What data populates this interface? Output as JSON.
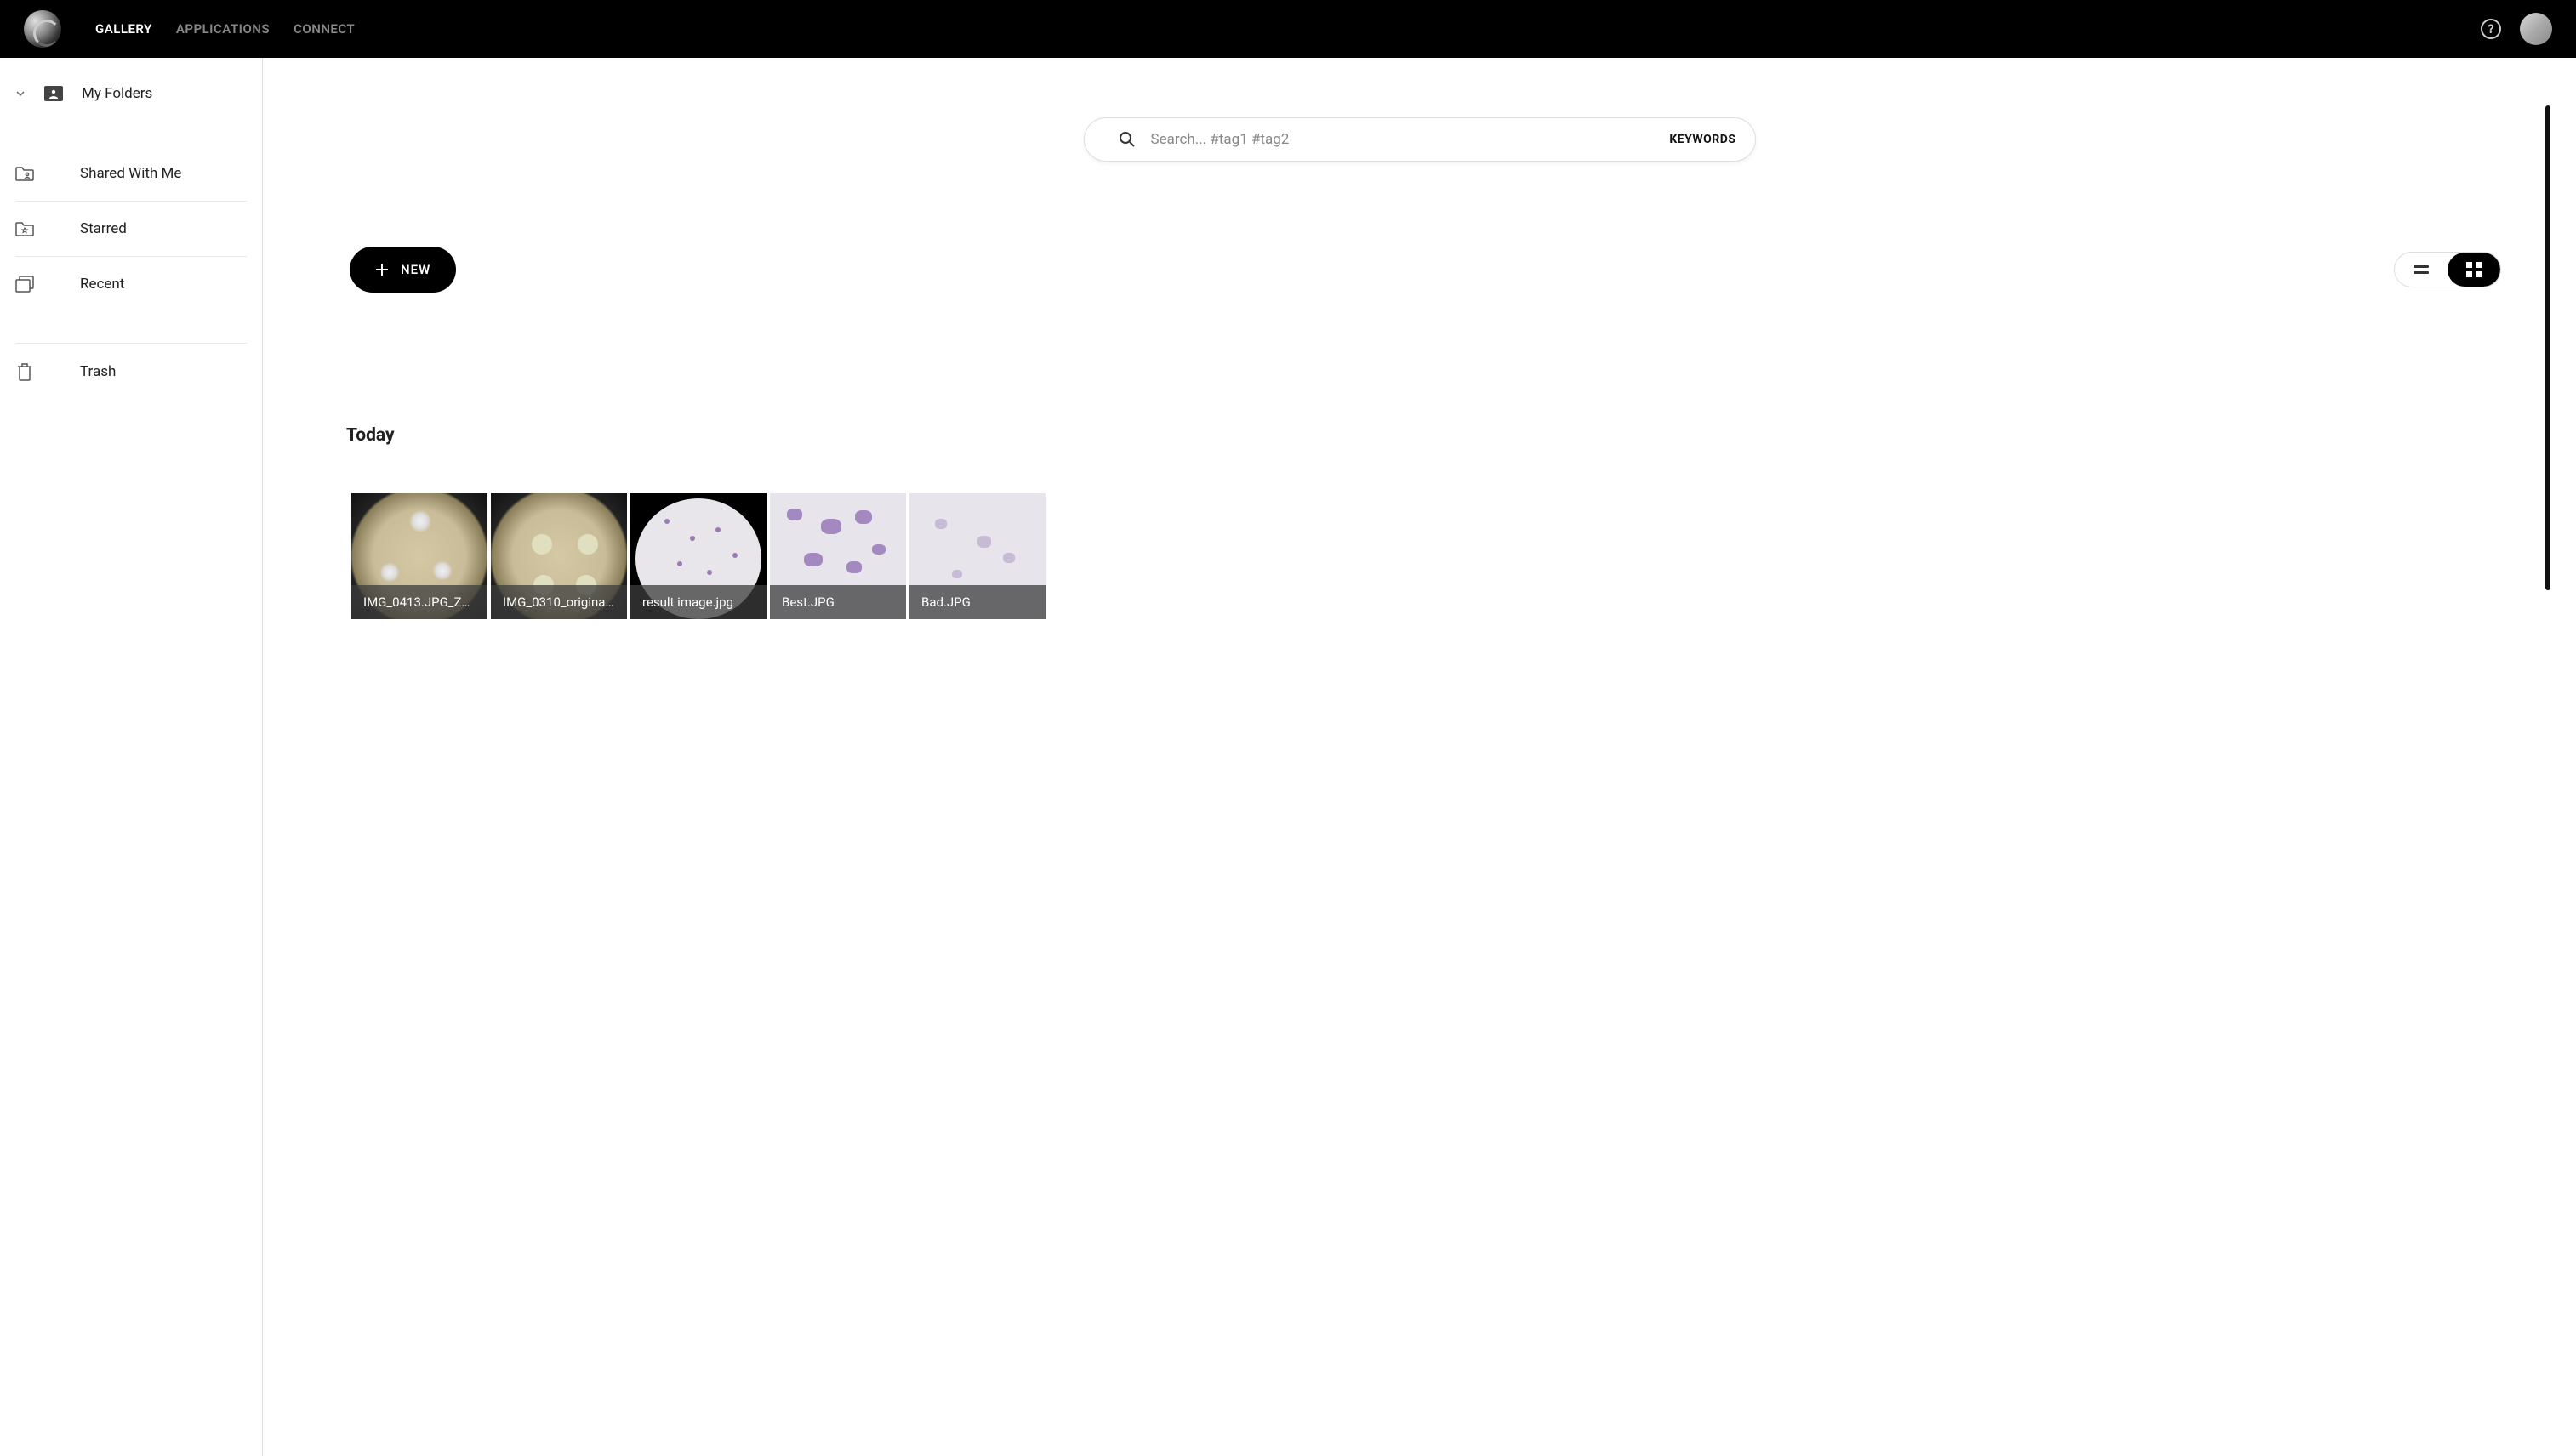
{
  "nav": {
    "items": [
      {
        "label": "GALLERY",
        "active": true
      },
      {
        "label": "APPLICATIONS",
        "active": false
      },
      {
        "label": "CONNECT",
        "active": false
      }
    ]
  },
  "sidebar": {
    "myFolders": "My Folders",
    "sharedWithMe": "Shared With Me",
    "starred": "Starred",
    "recent": "Recent",
    "trash": "Trash"
  },
  "search": {
    "placeholder": "Search... #tag1 #tag2",
    "keywordsLabel": "KEYWORDS"
  },
  "toolbar": {
    "newLabel": "NEW"
  },
  "section": {
    "title": "Today"
  },
  "thumbs": [
    {
      "caption": "IMG_0413.JPG_ZO…"
    },
    {
      "caption": "IMG_0310_original…"
    },
    {
      "caption": "result image.jpg"
    },
    {
      "caption": "Best.JPG"
    },
    {
      "caption": "Bad.JPG"
    }
  ]
}
